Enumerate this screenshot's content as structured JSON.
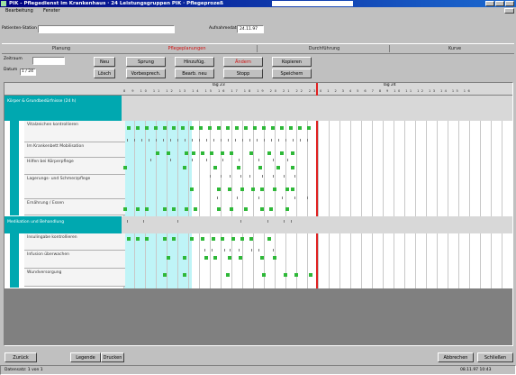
{
  "window": {
    "title": "PIK - Pflegedienst im Krankenhaus · 24 Leistungsgruppen PIK · Pflegeprozeß",
    "inner_title": "Pflegeprozeß"
  },
  "menu": [
    "Bearbeitung",
    "Fenster"
  ],
  "top_fields": {
    "left_label": "Patienten-Station",
    "left_value": "",
    "right_label": "Aufnahmedatum",
    "right_value": "24.11.97"
  },
  "tabs": [
    {
      "label": "Planung"
    },
    {
      "label": "Pflegeplanungen",
      "active": true
    },
    {
      "label": "Durchführung"
    },
    {
      "label": "Kurve"
    }
  ],
  "left_panel": {
    "label1": "Zeitraum",
    "label2": "Datum",
    "value1": "",
    "value2": "1 / 24"
  },
  "buttons": {
    "small_a": "Neu",
    "small_b": "Lösch",
    "row1": [
      "Sprung",
      "Hinzufüg.",
      "Ändern",
      "Kopieren"
    ],
    "row2": [
      "Vorbesprech.",
      "Bearb. neu",
      "Stopp",
      "Speichern"
    ]
  },
  "timeline": {
    "day1": "Tag 23",
    "day2": "Tag 24",
    "hours1": "8 9 10 11 12 13 14 15 16 17 18 19 20 21 22 23",
    "hours2": "0 1 2 3 4 5 6 7 8 9 10 11 12 13 14 15 16"
  },
  "groups": [
    {
      "title": "Körper & Grundbedürfnisse (24 h)",
      "rows": [
        "Vitalzeichen kontrollieren",
        "Im Krankenbett Mobilisation",
        "Hilfen bei Körperpflege",
        "Lagerungs- und Schmerzpflege",
        "Ernährung / Essen"
      ]
    },
    {
      "title": "Medikation und Behandlung",
      "rows": [
        "Insulingabe kontrollieren",
        "Infusion überwachen",
        "Wundversorgung"
      ]
    }
  ],
  "bottom": {
    "btn1": "Zurück",
    "btn2": "Legende",
    "btn3": "Drucken",
    "btn4": "Abbrechen",
    "btn5": "Schließen"
  },
  "status": {
    "left": "Datensatz: 1 von 1",
    "right": "08.11.97  10:43"
  },
  "colors": {
    "title_bar": "#000080",
    "teal": "#00a8b0",
    "cyan_bg": "#bff4f7",
    "green": "#2eb838",
    "red_line": "#e02020"
  }
}
